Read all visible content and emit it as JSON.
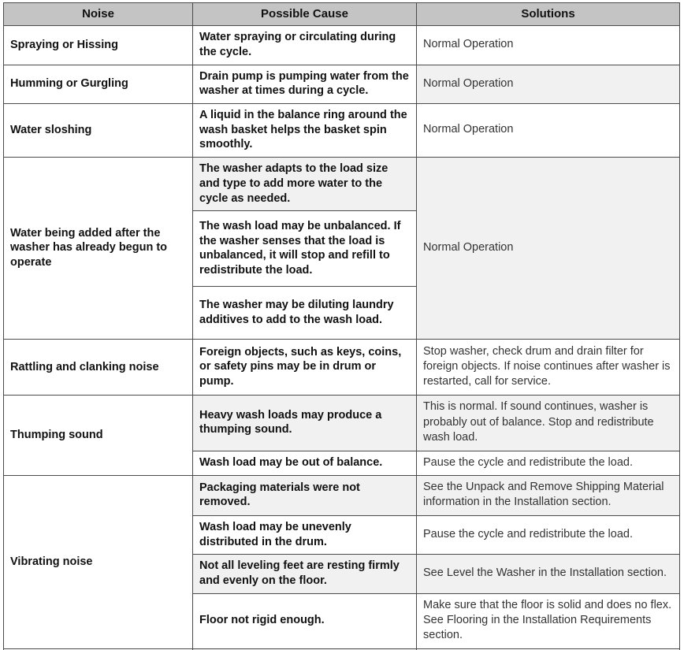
{
  "table": {
    "headers": [
      {
        "label": "Noise"
      },
      {
        "label": "Possible Cause"
      },
      {
        "label": "Solutions"
      }
    ],
    "colors": {
      "header_background": "#c4c4c4",
      "shaded_row_background": "#f1f1f1",
      "plain_row_background": "#ffffff",
      "border": "#4b4b4b",
      "noise_text": "#111111",
      "solution_text": "#333333"
    },
    "rows": [
      {
        "noise": "Spraying or Hissing",
        "cause": "Water spraying or circulating during the cycle.",
        "solution": "Normal Operation",
        "shaded": false
      },
      {
        "noise": "Humming or Gurgling",
        "cause": "Drain pump is pumping water from the washer at times during a cycle.",
        "solution": "Normal Operation",
        "shaded": true
      },
      {
        "noise": "Water sloshing",
        "cause": "A liquid in the balance ring around the wash basket helps the basket spin smoothly.",
        "solution": "Normal Operation",
        "shaded": false
      },
      {
        "noise": "Water being added after the washer has already begun to operate",
        "cause": "The washer adapts to the load size and type to add more water to the cycle as needed.",
        "solution": "Normal Operation",
        "shaded": true
      },
      {
        "noise": "",
        "cause": "The wash load may be unbalanced. If the washer senses that the load is unbalanced, it will stop and refill to redistribute the load.",
        "solution": "",
        "shaded": true
      },
      {
        "noise": "",
        "cause": "The washer may be diluting laundry additives to add to the wash load.",
        "solution": "",
        "shaded": true
      },
      {
        "noise": "Rattling and clanking noise",
        "cause": "Foreign objects, such as keys, coins, or safety pins may be in drum or pump.",
        "solution": "Stop washer, check drum and drain filter for foreign objects. If noise continues after washer is restarted, call for service.",
        "shaded": false
      },
      {
        "noise": "Thumping sound",
        "cause": "Heavy wash loads may produce a thumping sound.",
        "solution": "This is normal. If sound continues, washer is probably out of balance. Stop and redistribute wash load.",
        "shaded": true
      },
      {
        "noise": "",
        "cause": "Wash load may be out of balance.",
        "solution": "Pause the cycle and redistribute the load.",
        "shaded": false
      },
      {
        "noise": "Vibrating noise",
        "cause": "Packaging materials were not removed.",
        "solution": "See the Unpack and Remove Shipping Material information in the Installation section.",
        "shaded": true
      },
      {
        "noise": "",
        "cause": "Wash load may be unevenly distributed in the drum.",
        "solution": "Pause the cycle and redistribute the load.",
        "shaded": false
      },
      {
        "noise": "",
        "cause": "Not all leveling feet are resting firmly and evenly on the floor.",
        "solution": "See Level the Washer in the Installation section.",
        "shaded": true
      },
      {
        "noise": "",
        "cause": "Floor not rigid enough.",
        "solution": "Make sure that the floor is solid and does no flex. See Flooring in the Installation Requirements section.",
        "shaded": false
      }
    ]
  }
}
